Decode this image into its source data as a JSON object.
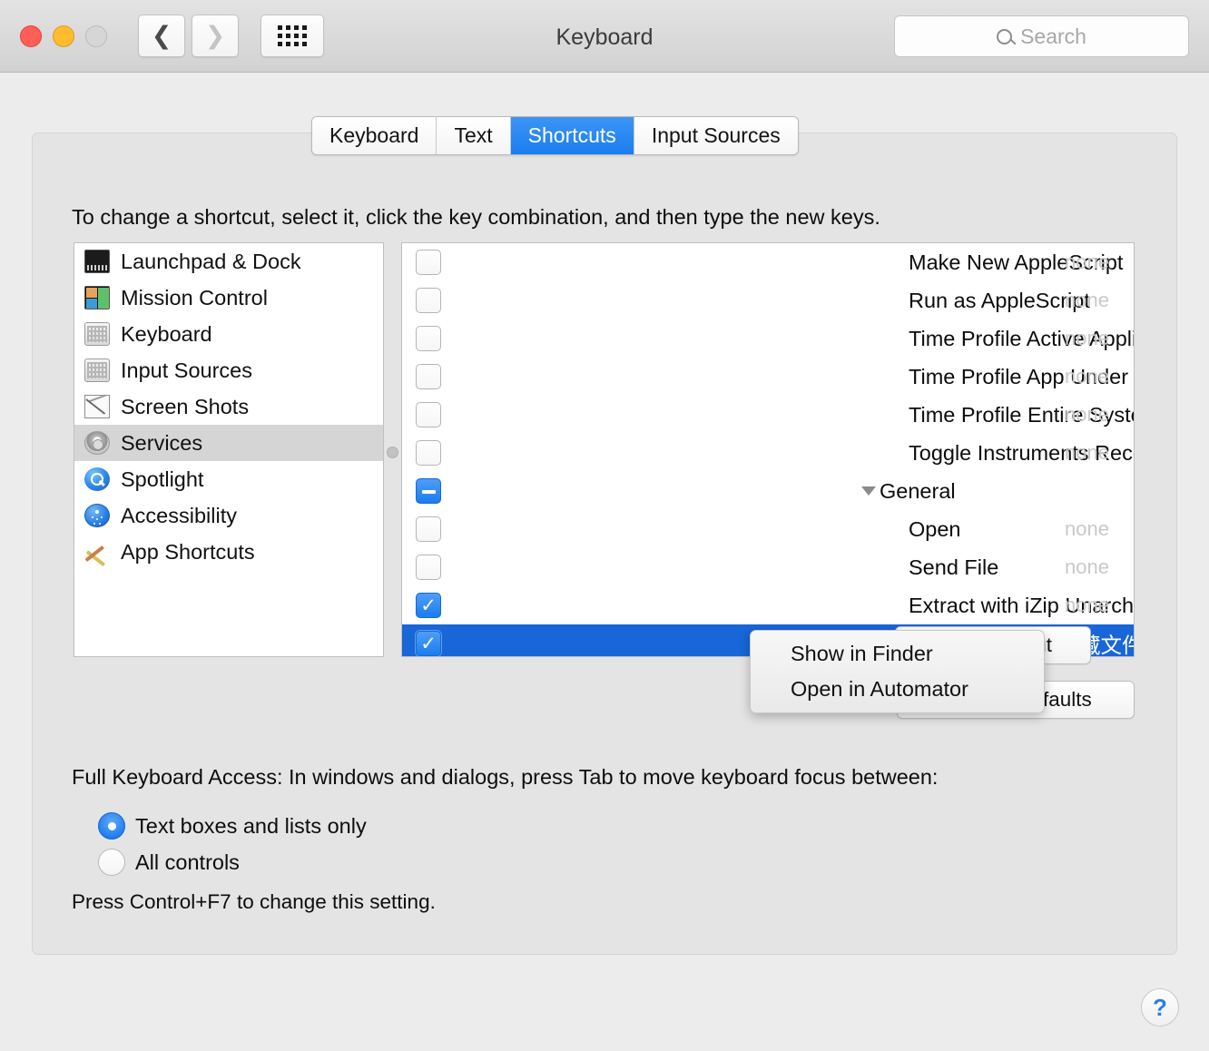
{
  "window": {
    "title": "Keyboard",
    "traffic": [
      "close",
      "minimize",
      "zoom"
    ],
    "nav": {
      "back": "‹",
      "forward": "›",
      "grid": "show-all"
    }
  },
  "search": {
    "placeholder": "Search"
  },
  "tabs": [
    {
      "label": "Keyboard",
      "active": false
    },
    {
      "label": "Text",
      "active": false
    },
    {
      "label": "Shortcuts",
      "active": true
    },
    {
      "label": "Input Sources",
      "active": false
    }
  ],
  "instruction": "To change a shortcut, select it, click the key combination, and then type the new keys.",
  "sidebar": {
    "items": [
      {
        "label": "Launchpad & Dock",
        "icon": "launchpad-icon",
        "selected": false
      },
      {
        "label": "Mission Control",
        "icon": "mission-control-icon",
        "selected": false
      },
      {
        "label": "Keyboard",
        "icon": "keyboard-icon",
        "selected": false
      },
      {
        "label": "Input Sources",
        "icon": "input-sources-icon",
        "selected": false
      },
      {
        "label": "Screen Shots",
        "icon": "screenshots-icon",
        "selected": false
      },
      {
        "label": "Services",
        "icon": "gear-icon",
        "selected": true
      },
      {
        "label": "Spotlight",
        "icon": "spotlight-icon",
        "selected": false
      },
      {
        "label": "Accessibility",
        "icon": "accessibility-icon",
        "selected": false
      },
      {
        "label": "App Shortcuts",
        "icon": "app-shortcuts-icon",
        "selected": false
      }
    ]
  },
  "shortcuts": {
    "rows": [
      {
        "name": "Make New AppleScript",
        "state": "off",
        "key": "none",
        "group": false,
        "selected": false
      },
      {
        "name": "Run as AppleScript",
        "state": "off",
        "key": "none",
        "group": false,
        "selected": false
      },
      {
        "name": "Time Profile Active Application",
        "state": "off",
        "key": "none",
        "group": false,
        "selected": false
      },
      {
        "name": "Time Profile App Under Mouse",
        "state": "off",
        "key": "none",
        "group": false,
        "selected": false
      },
      {
        "name": "Time Profile Entire System",
        "state": "off",
        "key": "none",
        "group": false,
        "selected": false
      },
      {
        "name": "Toggle Instruments Recording",
        "state": "off",
        "key": "none",
        "group": false,
        "selected": false
      },
      {
        "name": "General",
        "state": "mixed",
        "key": "",
        "group": true,
        "selected": false
      },
      {
        "name": "Open",
        "state": "off",
        "key": "none",
        "group": false,
        "selected": false
      },
      {
        "name": "Send File",
        "state": "off",
        "key": "none",
        "group": false,
        "selected": false
      },
      {
        "name": "Extract with iZip Unarchiver",
        "state": "on",
        "key": "none",
        "group": false,
        "selected": false
      },
      {
        "name": "打开或关闭显示隐藏文件",
        "state": "on",
        "key": "",
        "group": false,
        "selected": true
      }
    ]
  },
  "buttons": {
    "add_shortcut": "Add Shortcut",
    "restore_defaults": "Restore Defaults"
  },
  "context_menu": {
    "items": [
      "Show in Finder",
      "Open in Automator"
    ]
  },
  "full_keyboard_access": {
    "title": "Full Keyboard Access: In windows and dialogs, press Tab to move keyboard focus between:",
    "options": [
      {
        "label": "Text boxes and lists only",
        "selected": true
      },
      {
        "label": "All controls",
        "selected": false
      }
    ],
    "note": "Press Control+F7 to change this setting."
  },
  "help": {
    "label": "?"
  },
  "colors": {
    "accent": "#1a7df0",
    "selection": "#1866d8",
    "window_bg": "#ececec",
    "panel_bg": "#e4e4e4"
  }
}
